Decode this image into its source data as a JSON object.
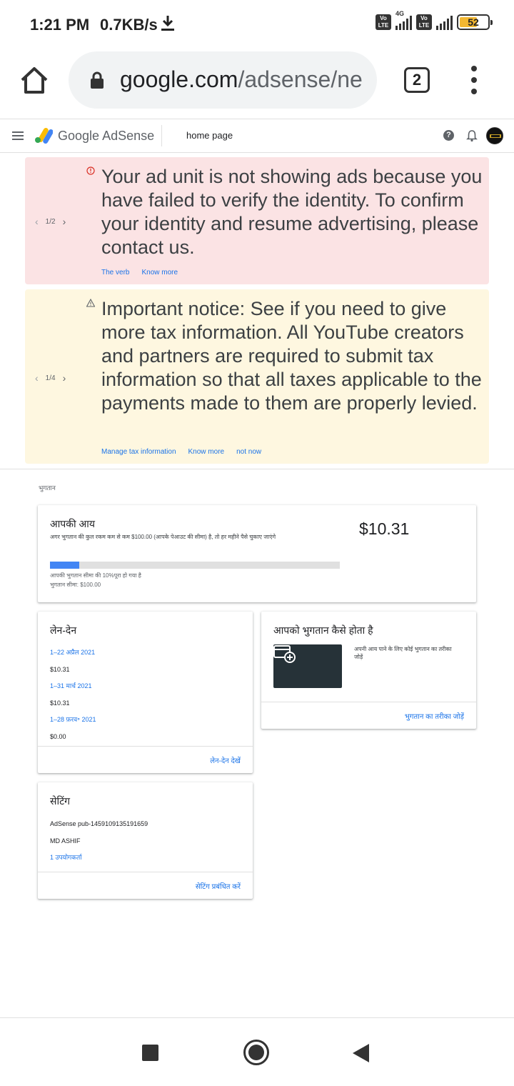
{
  "status_bar": {
    "time": "1:21 PM",
    "speed": "0.7KB/s",
    "network": "4G",
    "volte": "Vo LTE",
    "battery": "52"
  },
  "browser": {
    "url_host": "google.com",
    "url_path": "/adsense/ne",
    "tab_count": "2"
  },
  "header": {
    "brand_google": "Google",
    "brand_product": "AdSense",
    "page_title": "home page"
  },
  "alerts": [
    {
      "pager": "1/2",
      "message": "Your ad unit is not showing ads because you have failed to verify the identity. To confirm your identity and resume advertising, please contact us.",
      "links": [
        "The verb",
        "Know more"
      ]
    },
    {
      "pager": "1/4",
      "message": "Important notice: See if you need to give more tax information. All YouTube creators and partners are required to submit tax information so that all taxes applicable to the payments made to them are properly levied.",
      "links": [
        "Manage tax information",
        "Know more",
        "not now"
      ]
    }
  ],
  "section_label": "भुगतान",
  "earnings": {
    "title": "आपकी आय",
    "subtitle": "अगर भुगतान की कुल रकम कम से कम $100.00 (आपके पेआउट की सीमा) है, तो हर महीने पैसे चुकाए जाएंगे",
    "amount": "$10.31",
    "progress_fraction": 0.1,
    "progress_note": "आपकी भुगतान सीमा की 10%पूरा हो गया है",
    "threshold_note": "भुगतान सीमा: $100.00"
  },
  "transactions": {
    "title": "लेन-देन",
    "rows": [
      {
        "period": "1–22 अप्रैल 2021",
        "amount": "$10.31"
      },
      {
        "period": "1–31 मार्च 2021",
        "amount": "$10.31"
      },
      {
        "period": "1–28 फ़रव॰ 2021",
        "amount": "$0.00"
      }
    ],
    "footer_link": "लेन-देन देखें"
  },
  "payment_method": {
    "title": "आपको भुगतान कैसे होता है",
    "description": "अपनी आय पाने के लिए कोई भुगतान का तरीका जोड़ें",
    "footer_link": "भुगतान का तरीका जोड़ें"
  },
  "settings": {
    "title": "सेटिंग",
    "publisher_id": "AdSense pub-1459109135191659",
    "name": "MD ASHIF",
    "users": "1 उपयोगकर्ता",
    "footer_link": "सेटिंग प्रबंधित करें"
  },
  "colors": {
    "accent": "#1a73e8",
    "error_bg": "#fbe3e4",
    "warning_bg": "#fef7e0",
    "progress": "#4285f4"
  }
}
